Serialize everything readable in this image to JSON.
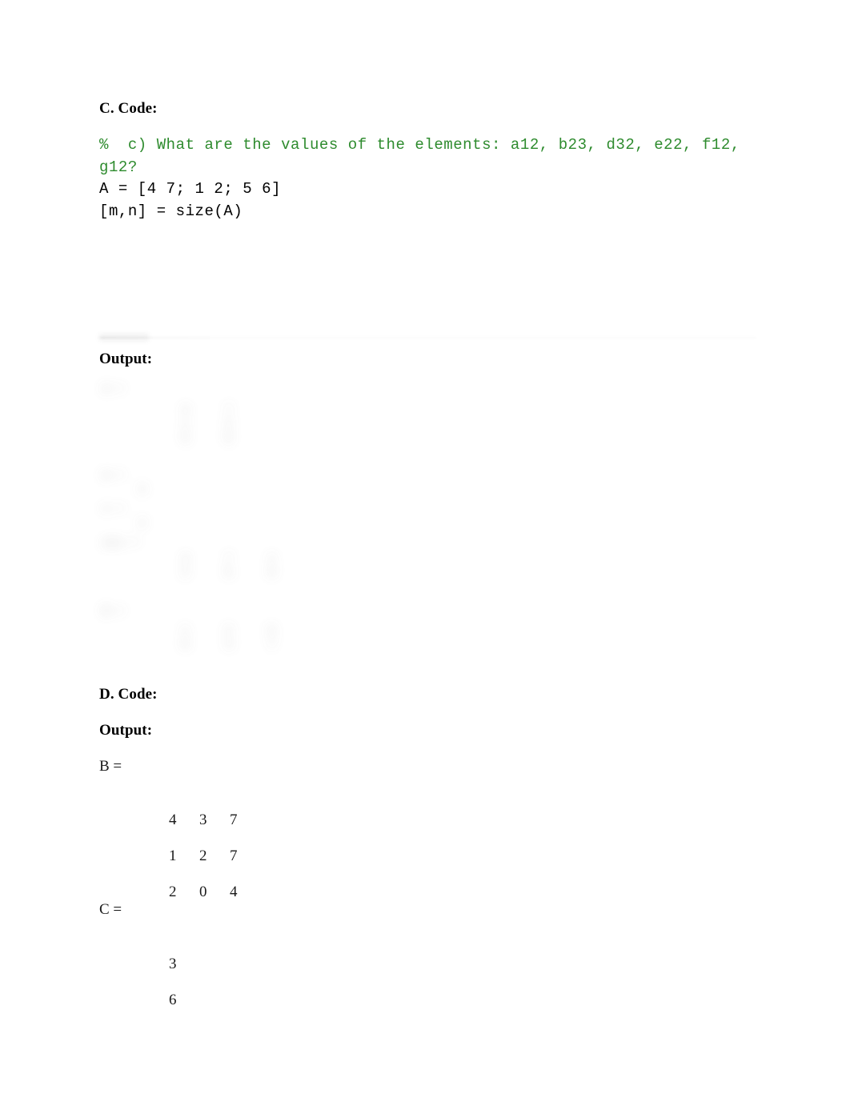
{
  "document": {
    "background_color": "#ffffff",
    "text_color": "#000000",
    "code_comment_color": "#2e8b2e"
  },
  "section_c": {
    "heading": "C. Code:",
    "code": {
      "comment": "%  c) What are the values of the elements: a12, b23, d32, e22, f12, g12?",
      "lines": [
        "A = [4 7; 1 2; 5 6]",
        "[m,n] = size(A)"
      ]
    },
    "output_heading": "Output:",
    "output_image": {
      "description": "blurred-matlab-console-screenshot",
      "lines": [
        "A =",
        "     4     7",
        "     1     2",
        "     5     6",
        "m =",
        "     3",
        "n =",
        "     2",
        "ans =",
        "     4     7     1",
        "     2     5     6",
        "B =",
        "     1     2     5",
        "     6     4     7"
      ]
    }
  },
  "section_d": {
    "heading": "D. Code:",
    "output_heading": "Output:",
    "results": [
      {
        "label": "B =",
        "rows": [
          [
            "4",
            "3",
            "7"
          ],
          [
            "1",
            "2",
            "7"
          ],
          [
            "2",
            "0",
            "4"
          ]
        ]
      },
      {
        "label": "C =",
        "rows": [
          [
            "3"
          ],
          [
            "6"
          ]
        ]
      }
    ]
  }
}
